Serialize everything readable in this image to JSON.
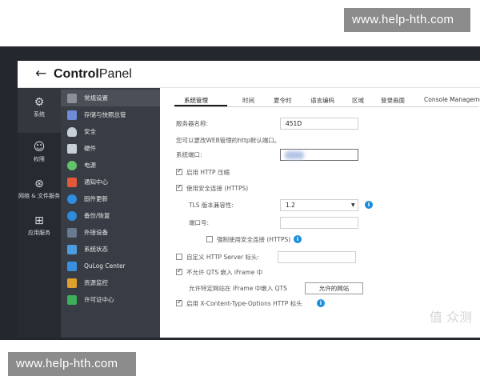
{
  "watermark": {
    "top": "www.help-hth.com",
    "bottom": "www.help-hth.com"
  },
  "titlebar": {
    "back_icon": "back-arrow-icon",
    "title_bold": "Control",
    "title_light": "Panel"
  },
  "rail": {
    "items": [
      {
        "label": "系统",
        "icon": "gear-icon"
      },
      {
        "label": "权限",
        "icon": "user-icon"
      },
      {
        "label": "网络 & 文件服务",
        "icon": "network-icon"
      },
      {
        "label": "应用服务",
        "icon": "grid-icon"
      }
    ]
  },
  "subnav": {
    "items": [
      {
        "label": "常规设置",
        "color": "#8a8f99"
      },
      {
        "label": "存储与快照总管",
        "color": "#6f8bd6"
      },
      {
        "label": "安全",
        "color": "#c9cfd8"
      },
      {
        "label": "硬件",
        "color": "#c9cfd8"
      },
      {
        "label": "电源",
        "color": "#62c36b"
      },
      {
        "label": "通知中心",
        "color": "#e05a3a"
      },
      {
        "label": "固件更新",
        "color": "#2e8de0"
      },
      {
        "label": "备份/恢复",
        "color": "#2e8de0"
      },
      {
        "label": "外接设备",
        "color": "#6a7a90"
      },
      {
        "label": "系统状态",
        "color": "#4a9de0"
      },
      {
        "label": "QuLog Center",
        "color": "#3a8fe0"
      },
      {
        "label": "资源监控",
        "color": "#e0a030"
      },
      {
        "label": "许可证中心",
        "color": "#3fae5a"
      }
    ]
  },
  "tabs": [
    "系统管理",
    "时间",
    "夏令时",
    "语言编码",
    "区域",
    "登录画面",
    "Console Management"
  ],
  "form": {
    "server_name_label": "服务器名称:",
    "server_name_value": "451D",
    "hint": "您可以更改WEB管理的http默认端口。",
    "system_port_label": "系统端口:",
    "http_compress": "启用 HTTP 压缩",
    "secure_conn": "使用安全连接 (HTTPS)",
    "tls_label": "TLS 版本兼容性:",
    "tls_value": "1.2",
    "port_label": "端口号:",
    "force_secure": "强制使用安全连接 (HTTPS)",
    "custom_header": "自定义 HTTP Server 标头:",
    "no_iframe": "不允许 QTS 嵌入 iFrame 中",
    "allow_sites_label": "允许特定网站在 iFrame 中嵌入 QTS",
    "allow_sites_button": "允许的网站",
    "xcto": "启用 X-Content-Type-Options HTTP 标头"
  },
  "corner_mark": "值 众测"
}
